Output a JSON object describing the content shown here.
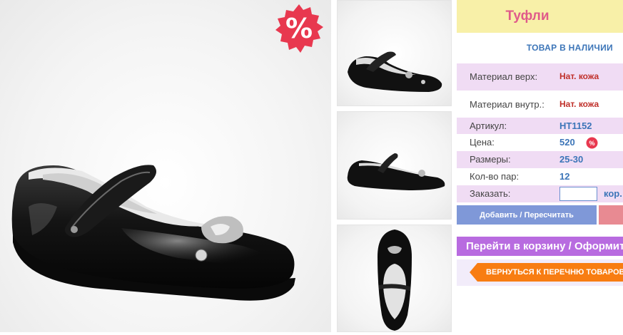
{
  "product": {
    "title": "Туфли",
    "stock_status": "ТОВАР В НАЛИЧИИ",
    "sale_badge": "%",
    "price_badge": "%"
  },
  "specs": [
    {
      "label": "Материал верх:",
      "value": "Нат. кожа"
    },
    {
      "label": "Материал внутр.:",
      "value": "Нат. кожа"
    },
    {
      "label": "Артикул:",
      "value": "HT1152"
    },
    {
      "label": "Цена:",
      "value": "520"
    },
    {
      "label": "Размеры:",
      "value": "25-30"
    },
    {
      "label": "Кол-во пар:",
      "value": "12"
    }
  ],
  "order": {
    "label": "Заказать:",
    "quantity_value": "",
    "unit": "кор."
  },
  "buttons": {
    "add_recalc": "Добавить / Пересчитать",
    "go_to_cart": "Перейти в корзину / Оформить заказ",
    "back_to_list": "ВЕРНУТЬСЯ К ПЕРЕЧНЮ ТОВАРОВ"
  },
  "colors": {
    "title_bg": "#f8f0a8",
    "title_text": "#e05a8a",
    "accent_blue": "#3c75b8",
    "value_red": "#c0302a",
    "row_pink": "#f0dcf4",
    "add_button": "#7f98d8",
    "cart_button": "#b86be0",
    "back_button": "#f87d12",
    "sale_badge": "#e8384f"
  },
  "icons": [
    "sale-percent-badge-icon",
    "price-percent-badge-icon",
    "arrow-left-icon"
  ]
}
